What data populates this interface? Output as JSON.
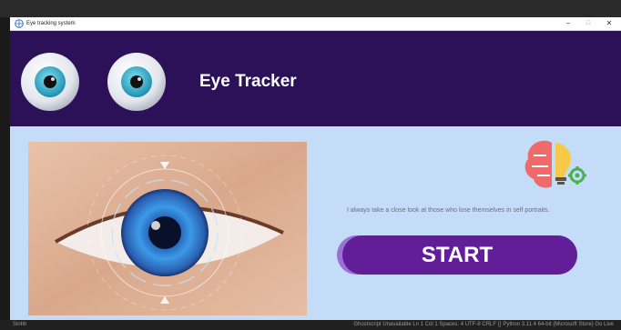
{
  "window": {
    "title": "Eye tracking system",
    "controls": {
      "minimize": "–",
      "maximize": "□",
      "close": "✕"
    }
  },
  "header": {
    "app_title": "Eye Tracker",
    "background_color": "#2d1158",
    "icons": [
      "eye-icon",
      "eye-icon"
    ]
  },
  "content": {
    "background_color": "#c4dcf7",
    "image": "futuristic-eye-scan-photo",
    "logo": "brain-lightbulb-gear-icon",
    "quote": "I always take a close look at those who lose themselves in self portraits.",
    "start_button": {
      "label": "START",
      "color": "#621e99"
    }
  },
  "taskbar": {
    "left_text": "Sinhh",
    "right_text": "Ghostscript Unavailable   Ln 1 Col 1   Spaces: 4   UTF-8   CRLF   {} Python   3.11.4 64-bit (Microsoft Store)   Go Live"
  }
}
